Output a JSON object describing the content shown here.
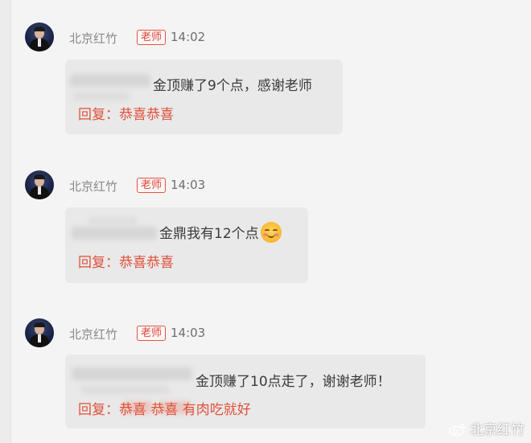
{
  "messages": [
    {
      "author": "北京红竹",
      "badge": "老师",
      "time": "14:02",
      "text": "金顶赚了9个点，感谢老师",
      "reply_prefix": "回复：",
      "reply_text": "恭喜恭喜"
    },
    {
      "author": "北京红竹",
      "badge": "老师",
      "time": "14:03",
      "text": "金鼎我有12个点",
      "emoji": "smiling-blush-emoji",
      "reply_prefix": "回复：",
      "reply_text": "恭喜恭喜"
    },
    {
      "author": "北京红竹",
      "badge": "老师",
      "time": "14:03",
      "text": "金顶赚了10点走了，谢谢老师！",
      "reply_prefix": "回复：",
      "reply_text": "恭喜 恭喜 有肉吃就好"
    }
  ],
  "watermark": {
    "icon": "weibo-icon",
    "text": "北京红竹"
  },
  "colors": {
    "reply": "#e0503a",
    "badge": "#d9453a",
    "bubble": "#e9e9e9",
    "background": "#f4f4f4"
  }
}
